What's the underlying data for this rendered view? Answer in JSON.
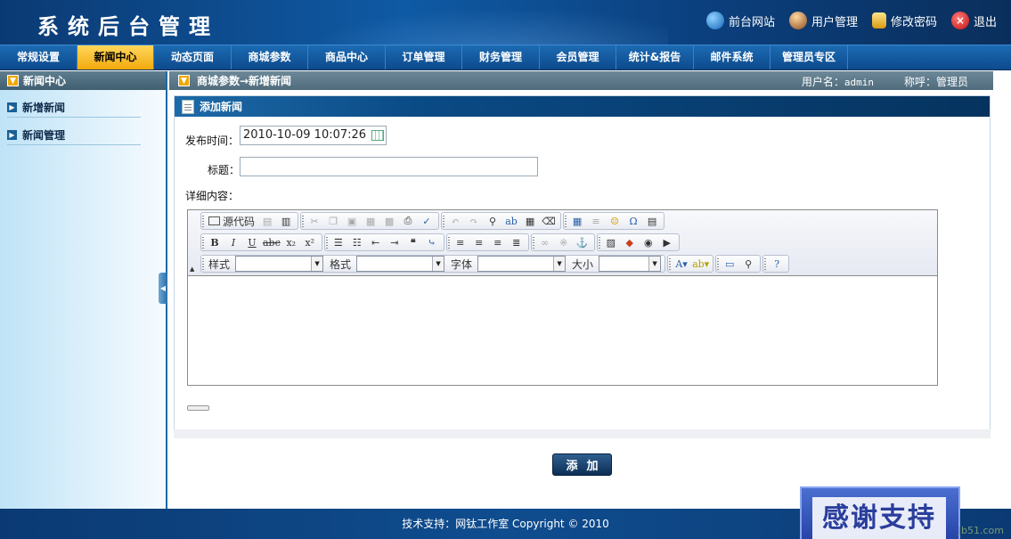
{
  "header": {
    "title": "系统后台管理",
    "links": [
      {
        "label": "前台网站",
        "icon": "globe-icon"
      },
      {
        "label": "用户管理",
        "icon": "user-icon"
      },
      {
        "label": "修改密码",
        "icon": "lock-icon"
      },
      {
        "label": "退出",
        "icon": "close-icon"
      }
    ]
  },
  "nav": {
    "items": [
      "常规设置",
      "新闻中心",
      "动态页面",
      "商城参数",
      "商品中心",
      "订单管理",
      "财务管理",
      "会员管理",
      "统计&报告",
      "邮件系统",
      "管理员专区"
    ],
    "active_index": 1
  },
  "sidebar": {
    "title": "新闻中心",
    "items": [
      {
        "label": "新增新闻"
      },
      {
        "label": "新闻管理"
      }
    ]
  },
  "breadcrumb": {
    "path": "商城参数→新增新闻",
    "username_label": "用户名：",
    "username": "admin",
    "nickname_label": "称呼：",
    "nickname": "管理员"
  },
  "form": {
    "panel_title": "添加新闻",
    "publish_time_label": "发布时间：",
    "publish_time_value": "2010-10-09 10:07:26",
    "title_label": "标题：",
    "title_value": "",
    "content_label": "详细内容：",
    "submit_label": "添加"
  },
  "editor": {
    "source_label": "源代码",
    "style_label": "样式",
    "format_label": "格式",
    "font_label": "字体",
    "size_label": "大小",
    "style_value": "",
    "format_value": "",
    "font_value": "",
    "size_value": ""
  },
  "footer": {
    "text": "技术支持：网钛工作室  Copyright © 2010",
    "thanks": "感谢支持",
    "watermark": "Jb51.com"
  },
  "colors": {
    "brand_dark": "#0b3a73",
    "nav_active": "#f2a90d",
    "panel_head": "#0a4a85"
  }
}
